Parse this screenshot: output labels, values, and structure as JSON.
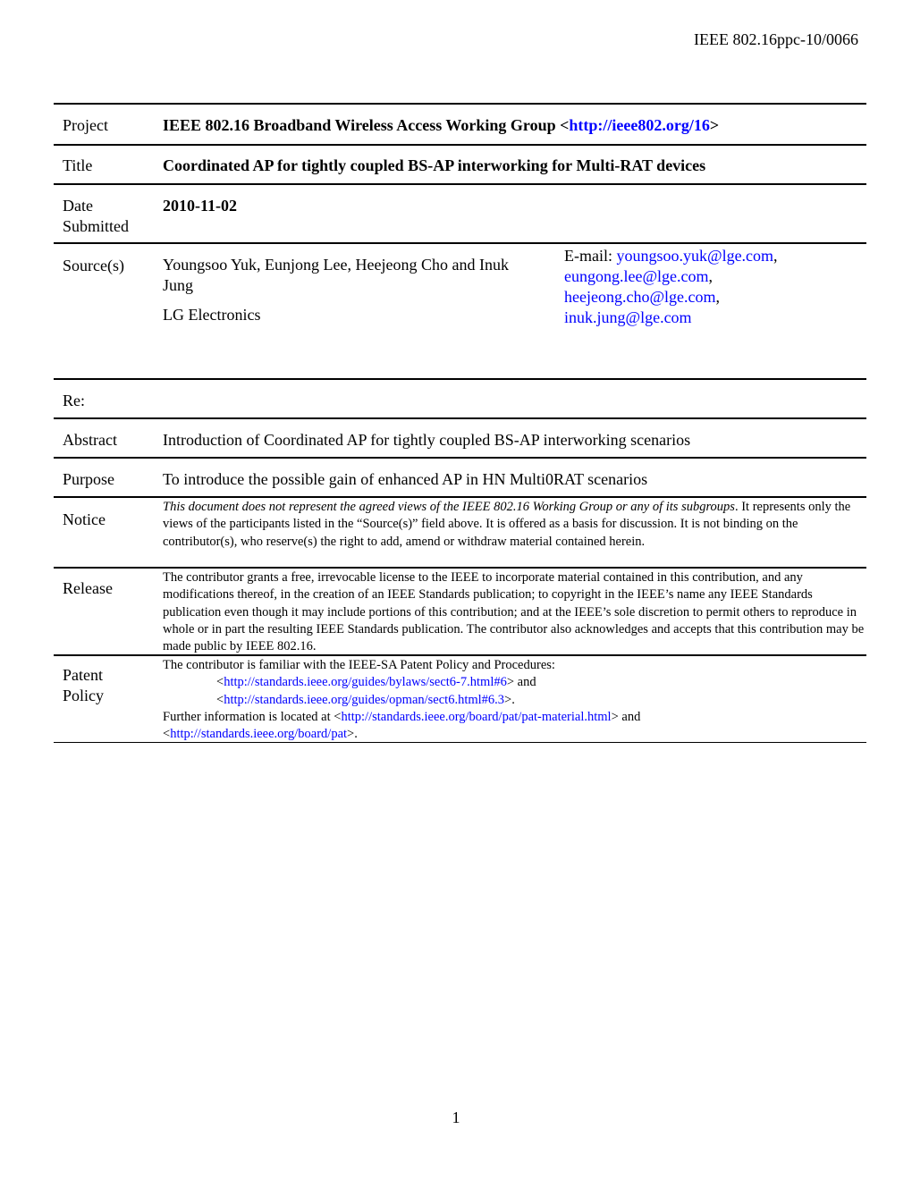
{
  "header": {
    "doc_id": "IEEE 802.16ppc-10/0066"
  },
  "cover": {
    "project": {
      "label": "Project",
      "value": "IEEE 802.16 Broadband Wireless Access Working Group <",
      "link": "http://ieee802.org/16",
      "suffix": ">"
    },
    "title": {
      "label": "Title",
      "value": "Coordinated AP for tightly coupled BS-AP interworking for Multi-RAT devices"
    },
    "date": {
      "label_line1": "Date",
      "label_line2": "Submitted",
      "value": "2010-11-02"
    },
    "source": {
      "label": "Source(s)",
      "authors": "Youngsoo Yuk, Eunjong Lee, Heejeong Cho and Inuk Jung",
      "organization": "LG Electronics",
      "email_label": "E-mail: ",
      "emails": [
        "youngsoo.yuk@lge.com",
        "eungong.lee@lge.com",
        "heejeong.cho@lge.com",
        "inuk.jung@lge.com"
      ],
      "separator": ","
    },
    "re": {
      "label": "Re:",
      "value": ""
    },
    "abstract": {
      "label": "Abstract",
      "value": "Introduction of Coordinated AP for tightly coupled BS-AP interworking scenarios"
    },
    "purpose": {
      "label": "Purpose",
      "value": "To introduce the possible gain of enhanced AP in HN Multi0RAT scenarios"
    },
    "notice": {
      "label": "Notice",
      "italic": "This document does not represent the agreed views of the IEEE 802.16 Working Group or any of its subgroups",
      "rest": ". It represents only the views of the participants listed in the “Source(s)” field above. It is offered as a basis for discussion. It is not binding on the contributor(s), who reserve(s) the right to add, amend or withdraw material contained herein."
    },
    "release": {
      "label": "Release",
      "value": "The contributor grants a free, irrevocable license to the IEEE to incorporate material contained in this contribution, and any modifications thereof, in the creation of an IEEE Standards publication; to copyright in the IEEE’s name any IEEE Standards publication even though it may include portions of this contribution; and at the IEEE’s sole discretion to permit others to reproduce in whole or in part the resulting IEEE Standards publication. The contributor also acknowledges and accepts that this contribution may be made public by IEEE 802.16."
    },
    "patent": {
      "label_line1": "Patent",
      "label_line2": "Policy",
      "intro": "The contributor is familiar with the IEEE-SA Patent Policy and Procedures:",
      "link1": "http://standards.ieee.org/guides/bylaws/sect6-7.html#6",
      "link1_suffix": "> and",
      "link2": "http://standards.ieee.org/guides/opman/sect6.html#6.3",
      "link2_suffix": ">.",
      "further": "Further information is located at <",
      "link3": "http://standards.ieee.org/board/pat/pat-material.html",
      "link3_suffix": "> and",
      "link4": "http://standards.ieee.org/board/pat",
      "link4_suffix": ">.",
      "lt": "<"
    }
  },
  "footer": {
    "page_number": "1"
  }
}
